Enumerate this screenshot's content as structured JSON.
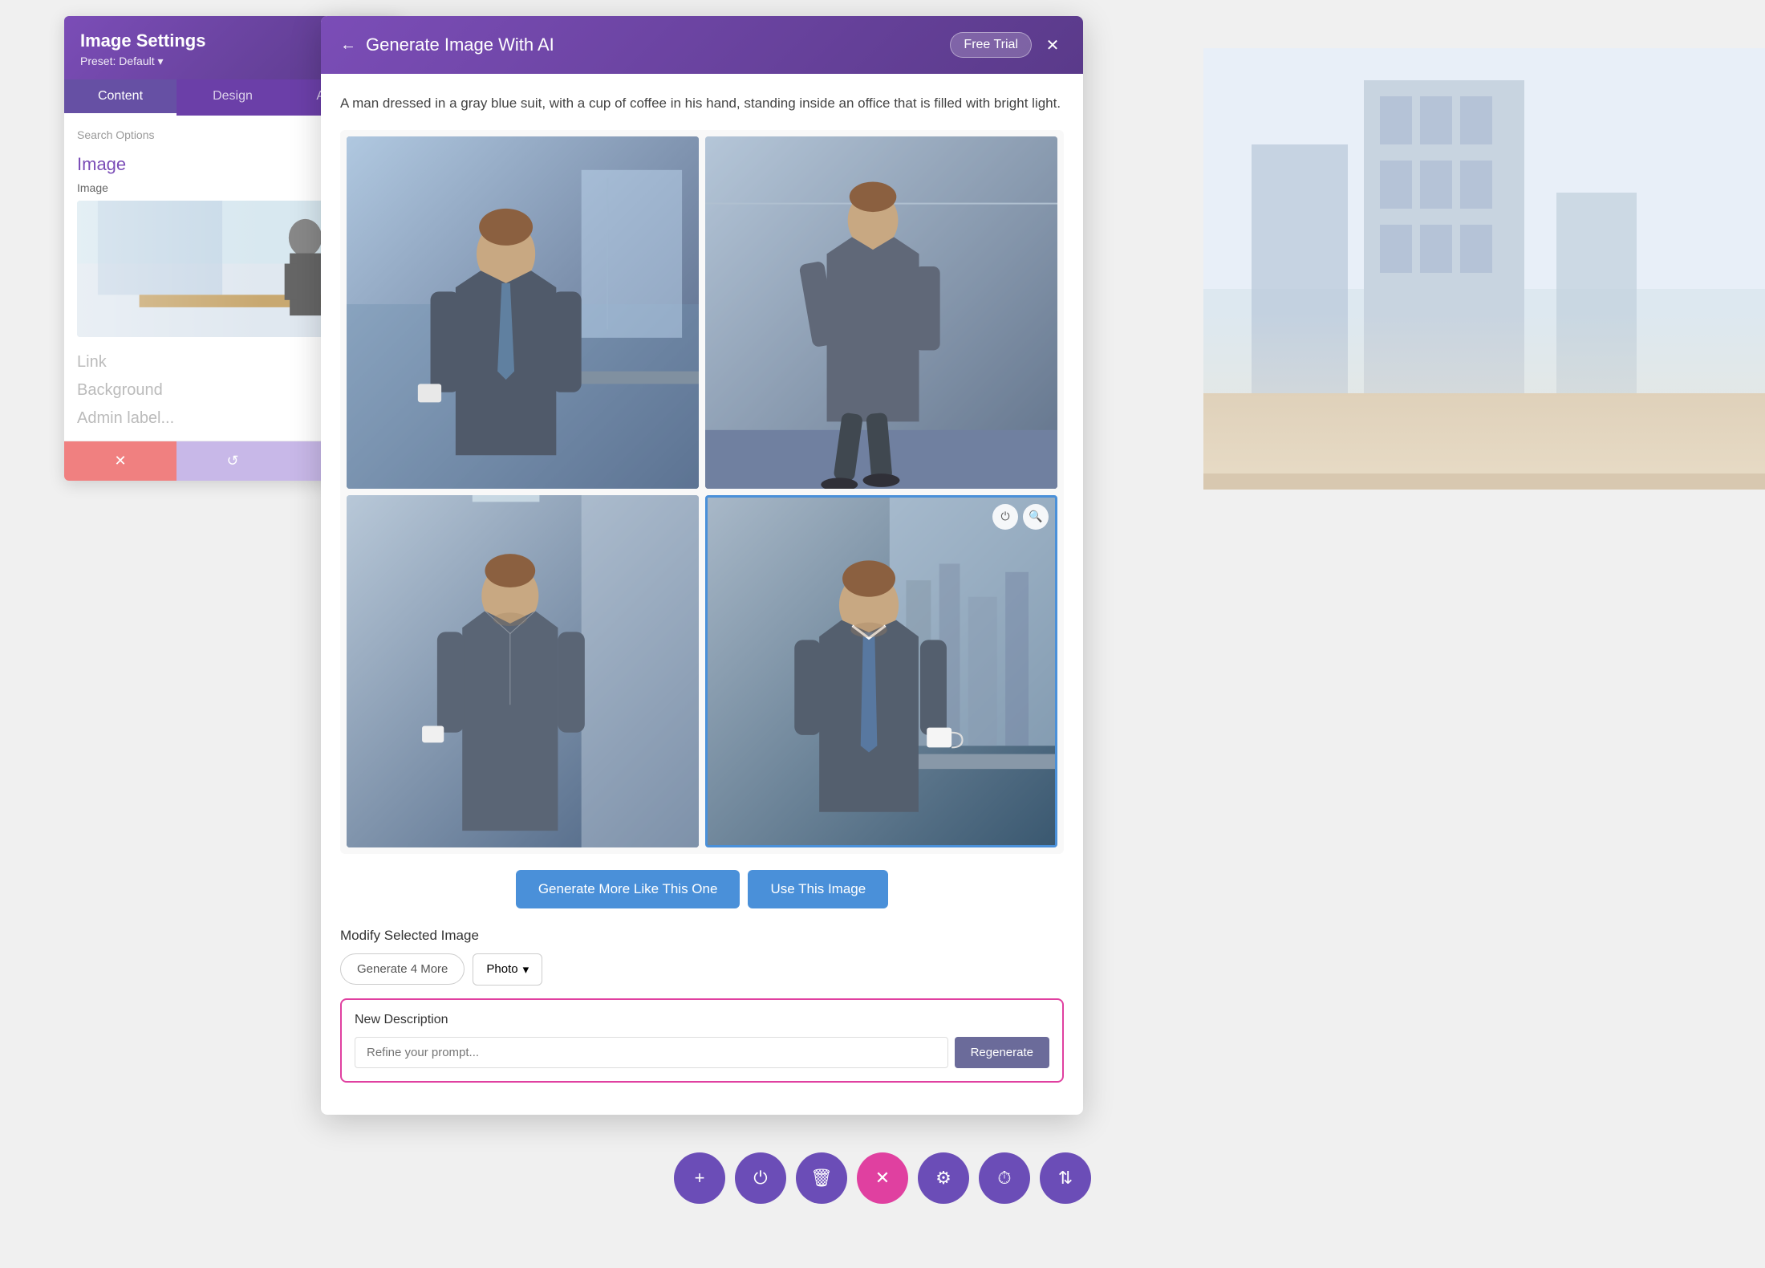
{
  "app": {
    "title": "Image Settings"
  },
  "left_panel": {
    "title": "Image Settings",
    "preset_label": "Preset: Default",
    "preset_arrow": "▾",
    "tabs": [
      {
        "id": "content",
        "label": "Content",
        "active": true
      },
      {
        "id": "design",
        "label": "Design",
        "active": false
      },
      {
        "id": "advanced",
        "label": "Advanced",
        "active": false
      }
    ],
    "search_placeholder": "Search Options",
    "section_image": "Image",
    "field_image": "Image",
    "section_link": "Link",
    "section_background": "Background",
    "section_admin": "Admin label",
    "actions": {
      "cancel": "✕",
      "undo": "↺",
      "redo": "↻"
    }
  },
  "modal": {
    "back_label": "←",
    "title": "Generate Image With AI",
    "free_trial": "Free Trial",
    "close": "✕",
    "prompt_text": "A man dressed in a gray blue suit, with a cup of coffee in his hand, standing inside an office that is filled with bright light.",
    "images": [
      {
        "id": 1,
        "selected": false,
        "alt": "Man in suit office image 1"
      },
      {
        "id": 2,
        "selected": false,
        "alt": "Man in suit office image 2"
      },
      {
        "id": 3,
        "selected": false,
        "alt": "Man in suit office image 3"
      },
      {
        "id": 4,
        "selected": true,
        "alt": "Man in suit office image 4 - selected"
      }
    ],
    "btn_generate_more": "Generate More Like This One",
    "btn_use_image": "Use This Image",
    "modify_title": "Modify Selected Image",
    "btn_generate_4": "Generate 4 More",
    "photo_type": "Photo",
    "photo_arrow": "▾",
    "new_description_title": "New Description",
    "new_description_placeholder": "Refine your prompt...",
    "btn_regenerate": "Regenerate"
  },
  "toolbar": {
    "buttons": [
      {
        "id": "add",
        "icon": "+",
        "label": "add",
        "active": false
      },
      {
        "id": "power",
        "icon": "⏻",
        "label": "power",
        "active": false
      },
      {
        "id": "delete",
        "icon": "🗑",
        "label": "delete",
        "active": false
      },
      {
        "id": "close",
        "icon": "✕",
        "label": "close",
        "active": true
      },
      {
        "id": "settings",
        "icon": "⚙",
        "label": "settings",
        "active": false
      },
      {
        "id": "history",
        "icon": "⏱",
        "label": "history",
        "active": false
      },
      {
        "id": "adjust",
        "icon": "⇅",
        "label": "adjust",
        "active": false
      }
    ]
  },
  "colors": {
    "purple": "#7b4db7",
    "purple_dark": "#5a3a8a",
    "blue": "#4a90d9",
    "pink": "#e040a0",
    "cancel_red": "#f08080",
    "toolbar_purple": "#6b4db7"
  }
}
